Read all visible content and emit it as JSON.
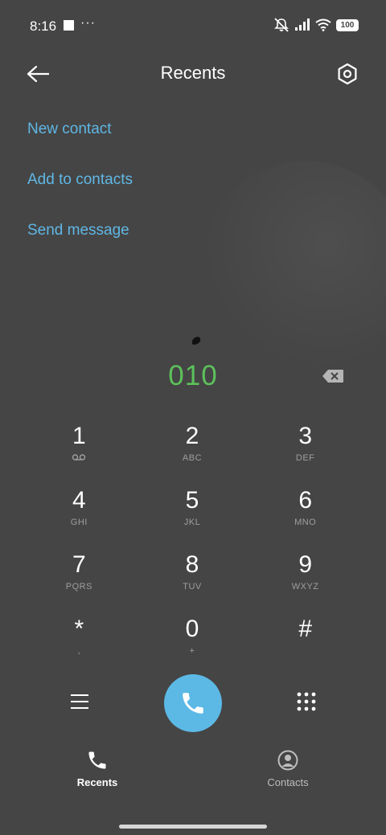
{
  "status_bar": {
    "time": "8:16",
    "overflow_dots": "···",
    "battery": "100"
  },
  "header": {
    "title": "Recents"
  },
  "actions": [
    {
      "label": "New contact"
    },
    {
      "label": "Add to contacts"
    },
    {
      "label": "Send message"
    }
  ],
  "dialer": {
    "number": "010"
  },
  "keypad": [
    {
      "digit": "1",
      "letters": ""
    },
    {
      "digit": "2",
      "letters": "ABC"
    },
    {
      "digit": "3",
      "letters": "DEF"
    },
    {
      "digit": "4",
      "letters": "GHI"
    },
    {
      "digit": "5",
      "letters": "JKL"
    },
    {
      "digit": "6",
      "letters": "MNO"
    },
    {
      "digit": "7",
      "letters": "PQRS"
    },
    {
      "digit": "8",
      "letters": "TUV"
    },
    {
      "digit": "9",
      "letters": "WXYZ"
    },
    {
      "digit": "*",
      "letters": ","
    },
    {
      "digit": "0",
      "letters": "+"
    },
    {
      "digit": "#",
      "letters": ""
    }
  ],
  "tabs": [
    {
      "label": "Recents",
      "active": true
    },
    {
      "label": "Contacts",
      "active": false
    }
  ],
  "colors": {
    "background": "#454545",
    "accent": "#5fb7e4",
    "number": "#5cc15b",
    "call_button": "#5cb9e6"
  }
}
